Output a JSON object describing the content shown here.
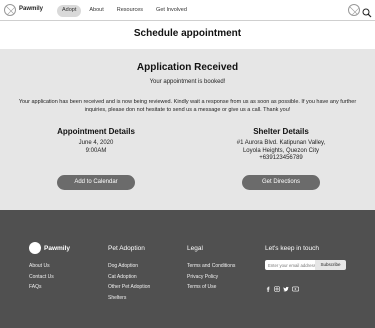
{
  "header": {
    "brand": "Pawmily",
    "nav": [
      {
        "label": "Adopt",
        "active": true
      },
      {
        "label": "About",
        "active": false
      },
      {
        "label": "Resources",
        "active": false
      },
      {
        "label": "Get Involved",
        "active": false
      }
    ],
    "icons": [
      "logo-placeholder-icon",
      "avatar-placeholder-icon",
      "search-icon"
    ]
  },
  "page": {
    "title": "Schedule appointment"
  },
  "application": {
    "title": "Application Received",
    "booked": "Your appointment is booked!",
    "description": "Your application has been received and is now being reviewed. Kindly wait a response from us as soon as possible. If you have any further inquiries, please don not hesitate to send us a message or give us a call. Thank you!"
  },
  "appointment": {
    "heading": "Appointment Details",
    "date": "June 4, 2020",
    "time": "9:00AM",
    "button": "Add to Calendar"
  },
  "shelter": {
    "heading": "Shelter Details",
    "address_line1": "#1 Aurora Blvd. Katipunan Valley,",
    "address_line2": "Loyola Heights, Quezon City",
    "phone": "+639123456789",
    "button": "Get Directions"
  },
  "footer": {
    "brand": "Pawmily",
    "brand_links": [
      "About Us",
      "Contact Us",
      "FAQs"
    ],
    "pet_adoption": {
      "heading": "Pet Adoption",
      "links": [
        "Dog Adoption",
        "Cat Adoption",
        "Other Pet Adoption",
        "Shelters"
      ]
    },
    "legal": {
      "heading": "Legal",
      "links": [
        "Terms and Conditions",
        "Privacy Policy",
        "Terms of Use"
      ]
    },
    "newsletter": {
      "heading": "Let's keep in touch",
      "email_placeholder": "Enter your email address",
      "subscribe": "Subscribe"
    },
    "social_icons": [
      "facebook-icon",
      "instagram-icon",
      "twitter-icon",
      "youtube-icon"
    ]
  },
  "colors": {
    "main_bg": "#e6e6e6",
    "button_bg": "#6b6b6b",
    "footer_bg": "#505050",
    "nav_active_bg": "#d9d9d9"
  }
}
